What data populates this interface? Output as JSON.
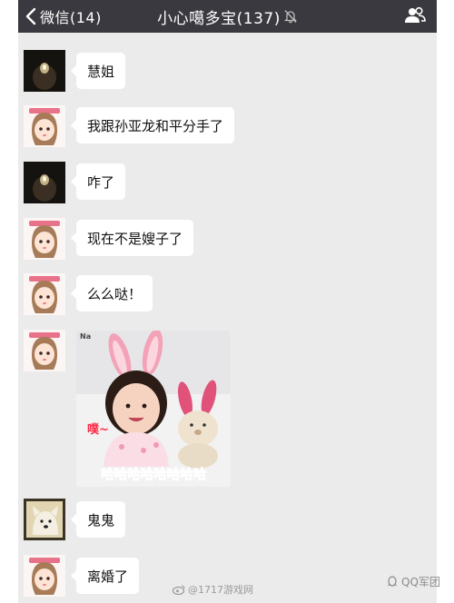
{
  "header": {
    "back_label": "微信(14)",
    "title": "小心噶多宝(137)"
  },
  "messages": [
    {
      "sender_avatar": "dark-photo-avatar",
      "text": "慧姐"
    },
    {
      "sender_avatar": "cartoon-girl-avatar",
      "text": "我跟孙亚龙和平分手了"
    },
    {
      "sender_avatar": "dark-photo-avatar",
      "text": "咋了"
    },
    {
      "sender_avatar": "cartoon-girl-avatar",
      "text": "现在不是嫂子了"
    },
    {
      "sender_avatar": "cartoon-girl-avatar",
      "text": "么么哒！"
    },
    {
      "sender_avatar": "cartoon-girl-avatar",
      "sticker": {
        "tag": "Na",
        "sfx": "噗~",
        "caption": "哈哈哈哈哈哈哈哈"
      }
    },
    {
      "sender_avatar": "dog-avatar",
      "text": "鬼鬼"
    },
    {
      "sender_avatar": "cartoon-girl-avatar",
      "text": "离婚了"
    }
  ],
  "watermarks": {
    "weibo": "@1717游戏网",
    "qq": "QQ军团"
  },
  "colors": {
    "header_bg": "#3a393f",
    "chat_bg": "#ebebeb",
    "bubble_bg": "#ffffff",
    "sticker_caption": "#ff2a44"
  }
}
